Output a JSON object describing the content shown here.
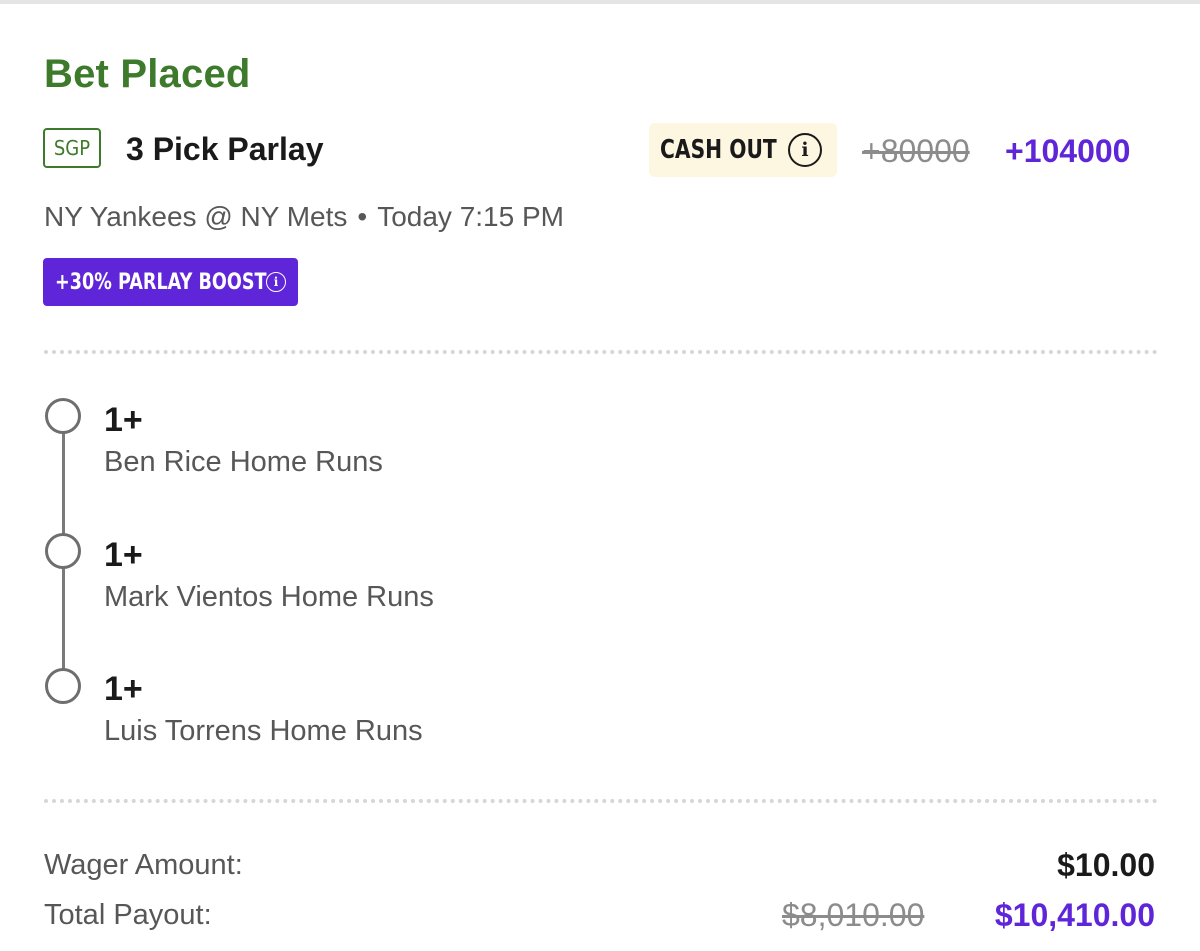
{
  "header": {
    "title": "Bet Placed"
  },
  "bet": {
    "type_badge": "SGP",
    "name": "3 Pick Parlay",
    "cash_out_label": "CASH OUT",
    "odds_original": "+80000",
    "odds_boosted": "+104000",
    "game": "NY Yankees @ NY Mets",
    "separator": "•",
    "time": "Today 7:15 PM",
    "boost_label": "+30% PARLAY BOOST"
  },
  "legs": [
    {
      "value": "1+",
      "market": "Ben Rice Home Runs"
    },
    {
      "value": "1+",
      "market": "Mark Vientos Home Runs"
    },
    {
      "value": "1+",
      "market": "Luis Torrens Home Runs"
    }
  ],
  "summary": {
    "wager_label": "Wager Amount:",
    "wager_value": "$10.00",
    "payout_label": "Total Payout:",
    "payout_original": "$8,010.00",
    "payout_boosted": "$10,410.00"
  },
  "icons": {
    "info": "info-icon",
    "leg_status": "empty-circle-icon"
  },
  "colors": {
    "title_green": "#3d7a2c",
    "boost_purple": "#5f25d9",
    "cashout_bg": "#fdf6e1",
    "strikethrough_grey": "#8c8c8c"
  }
}
